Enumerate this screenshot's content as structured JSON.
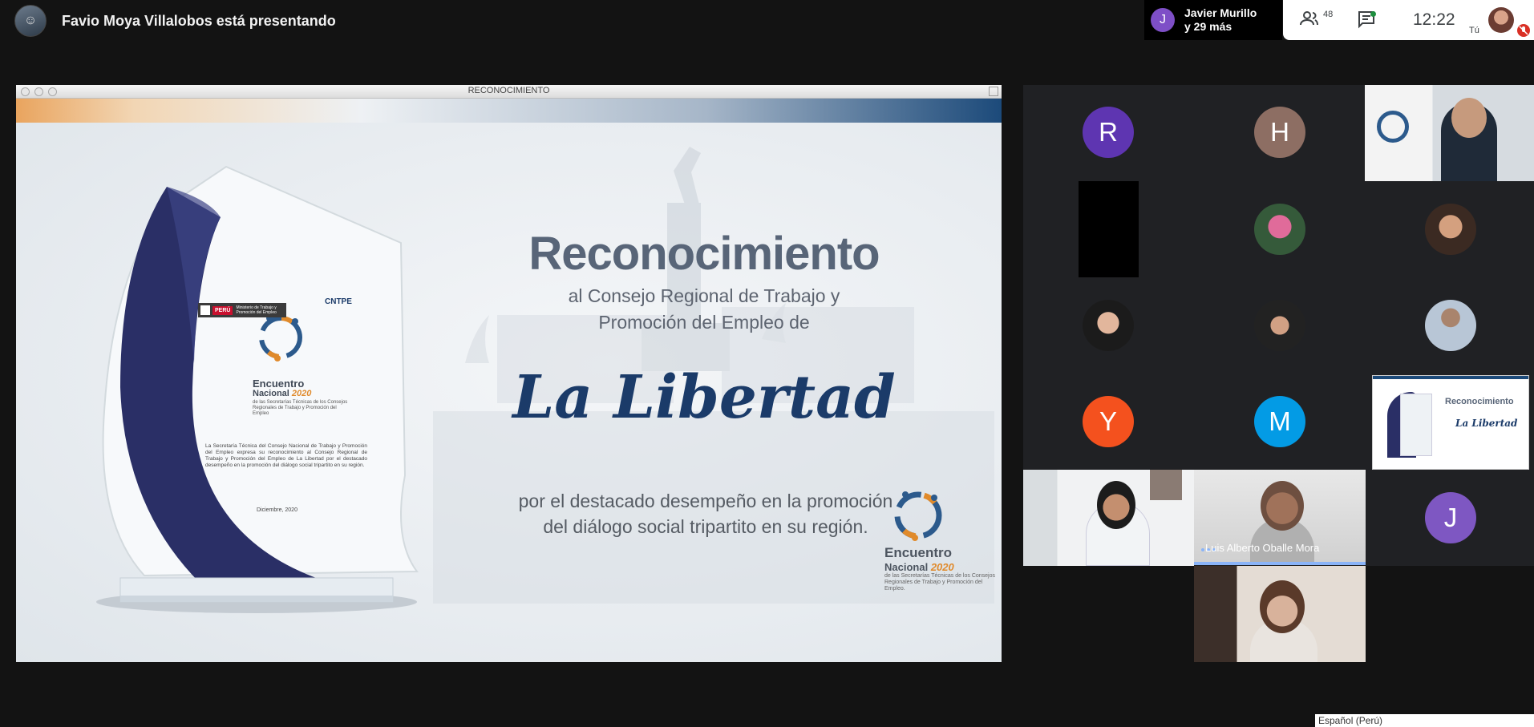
{
  "topbar": {
    "presenter_text": "Favio Moya Villalobos está presentando",
    "joined_name": "Javier Murillo",
    "joined_more": "y 29 más",
    "joined_initial": "J",
    "participants_count": "48",
    "clock": "12:22",
    "self_label": "Tú"
  },
  "presentation": {
    "window_title": "RECONOCIMIENTO",
    "slide": {
      "title": "Reconocimiento",
      "subtitle_line1": "al Consejo Regional de Trabajo y",
      "subtitle_line2": "Promoción del Empleo de",
      "region": "La Libertad",
      "desc_line1": "por el destacado desempeño en la promoción",
      "desc_line2": "del diálogo social tripartito en su región.",
      "logo_line1": "Encuentro",
      "logo_line2": "Nacional",
      "logo_year": "2020",
      "logo_small": "de las Secretarías Técnicas de los Consejos Regionales de Trabajo y Promoción del Empleo.",
      "trophy": {
        "peru": "PERÚ",
        "ministry": "Ministerio de Trabajo y Promoción del Empleo",
        "cntpe": "CNTPE",
        "encuentro": "Encuentro",
        "nacional": "Nacional",
        "year": "2020",
        "small": "de las Secretarías Técnicas de los Consejos Regionales de Trabajo y Promoción del Empleo",
        "body": "La Secretaría Técnica del Consejo Nacional de Trabajo y Promoción del Empleo expresa su reconocimiento al Consejo Regional de Trabajo y Promoción del Empleo de La Libertad por el destacado desempeño en la promoción del diálogo social tripartito en su región.",
        "date": "Diciembre, 2020"
      }
    }
  },
  "participants": {
    "initials": [
      {
        "letter": "R",
        "color": "#5e35b1"
      },
      {
        "letter": "H",
        "color": "#8d6e63"
      },
      {
        "letter": "Y",
        "color": "#f4511e"
      },
      {
        "letter": "M",
        "color": "#039be5"
      },
      {
        "letter": "J",
        "color": "#7e57c2"
      }
    ],
    "thumb_title": "Reconocimiento",
    "thumb_region": "La Libertad",
    "speaker_name": "Luis Alberto Oballe Mora"
  },
  "status": {
    "caption_language": "Español (Perú)"
  }
}
